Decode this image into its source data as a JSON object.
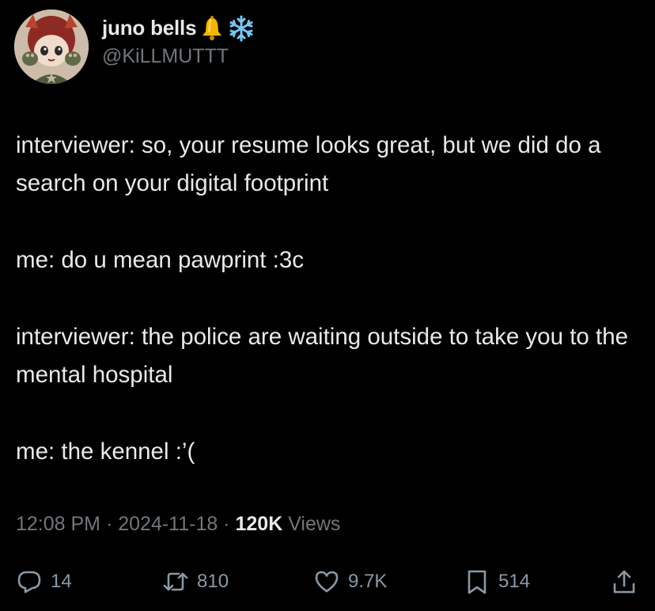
{
  "author": {
    "display_name": "juno bells",
    "badges": [
      "bell-emoji",
      "snowflake-emoji"
    ],
    "handle": "@KiLLMUTTT"
  },
  "tweet": {
    "paragraphs": [
      "interviewer: so, your resume looks great, but we did do a search on your digital footprint",
      "me: do u mean pawprint :3c",
      "interviewer: the police are waiting outside to take you to the mental hospital",
      "me: the kennel :’("
    ]
  },
  "meta": {
    "time": "12:08 PM",
    "sep1": " · ",
    "date": "2024-11-18",
    "sep2": " · ",
    "views_count": "120K",
    "views_label": " Views"
  },
  "actions": {
    "replies": "14",
    "reposts": "810",
    "likes": "9.7K",
    "bookmarks": "514"
  },
  "icons": [
    "reply-icon",
    "repost-icon",
    "like-icon",
    "bookmark-icon",
    "share-icon"
  ],
  "colors": {
    "background": "#000000",
    "text": "#e7e9ea",
    "muted": "#71767b"
  }
}
